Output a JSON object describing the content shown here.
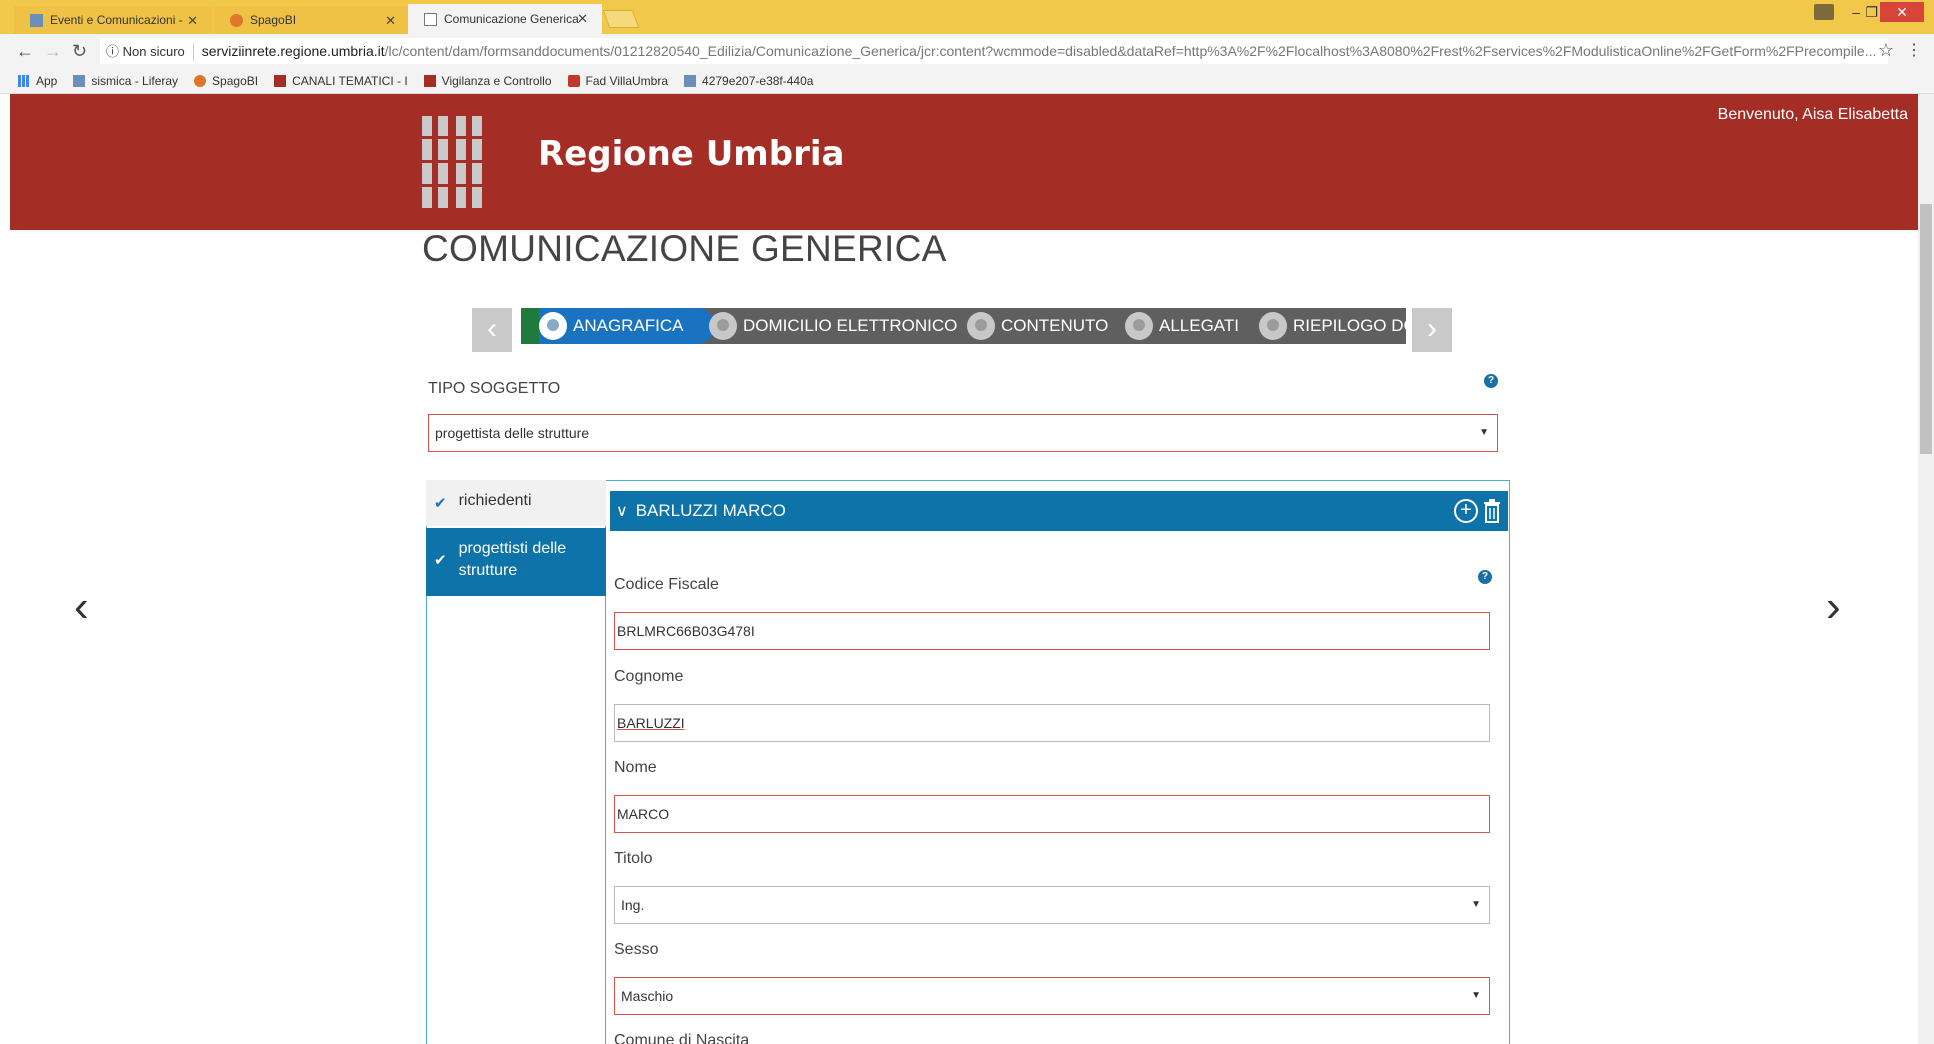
{
  "browser": {
    "tabs": [
      {
        "title": "Eventi e Comunicazioni -"
      },
      {
        "title": "SpagoBI"
      },
      {
        "title": "Comunicazione Generica"
      }
    ],
    "security": "Non sicuro",
    "url_host": "serviziinrete.regione.umbria.it",
    "url_path": "/lc/content/dam/formsanddocuments/01212820540_Edilizia/Comunicazione_Generica/jcr:content?wcmmode=disabled&dataRef=http%3A%2F%2Flocalhost%3A8080%2Frest%2Fservices%2FModulisticaOnline%2FGetForm%2FPrecompile...",
    "bookmarks": [
      {
        "label": "App"
      },
      {
        "label": "sismica - Liferay"
      },
      {
        "label": "SpagoBI"
      },
      {
        "label": "CANALI TEMATICI - I"
      },
      {
        "label": "Vigilanza e Controllo"
      },
      {
        "label": "Fad VillaUmbra"
      },
      {
        "label": "4279e207-e38f-440a"
      }
    ]
  },
  "header": {
    "brand": "Regione Umbria",
    "welcome": "Benvenuto, Aisa Elisabetta",
    "color": "#a42d25"
  },
  "page_title": "COMUNICAZIONE GENERICA",
  "wizard": {
    "steps": [
      {
        "label": "ANAGRAFICA",
        "active": true
      },
      {
        "label": "DOMICILIO ELETTRONICO"
      },
      {
        "label": "CONTENUTO"
      },
      {
        "label": "ALLEGATI"
      },
      {
        "label": "RIEPILOGO DOM"
      }
    ]
  },
  "form": {
    "tipo_label": "TIPO SOGGETTO",
    "tipo_value": "progettista delle strutture",
    "side_items": [
      {
        "label": "richiedenti"
      },
      {
        "label": "progettisti delle strutture"
      }
    ],
    "accordion_title": "BARLUZZI MARCO",
    "fields": {
      "codice_fiscale_label": "Codice Fiscale",
      "codice_fiscale_value": "BRLMRC66B03G478I",
      "cognome_label": "Cognome",
      "cognome_value": "BARLUZZI",
      "nome_label": "Nome",
      "nome_value": "MARCO",
      "titolo_label": "Titolo",
      "titolo_value": "Ing.",
      "sesso_label": "Sesso",
      "sesso_value": "Maschio",
      "comune_label": "Comune di Nascita"
    }
  },
  "help_mark": "?"
}
